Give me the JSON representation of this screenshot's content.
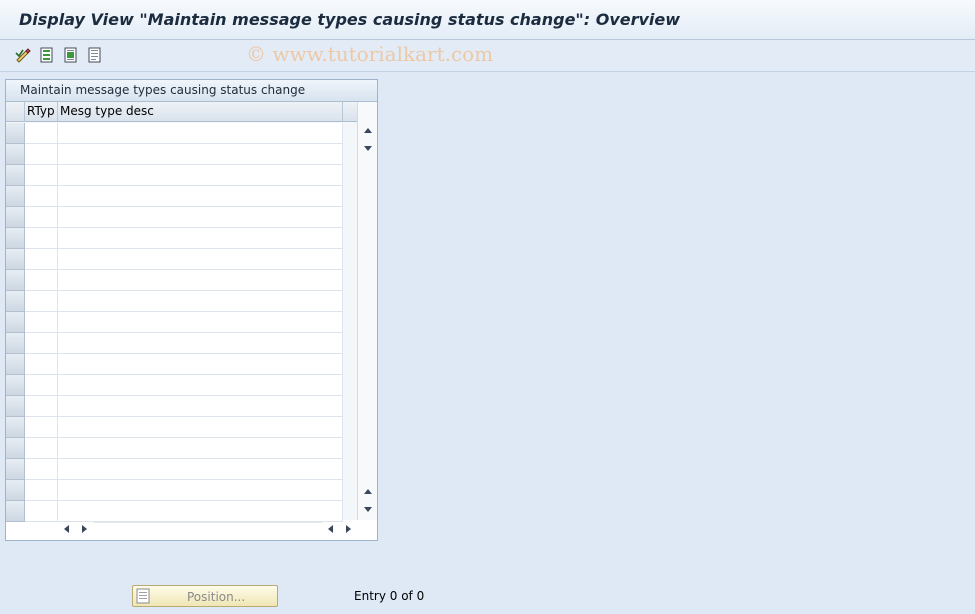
{
  "window": {
    "title": "Display View \"Maintain message types causing status change\": Overview"
  },
  "toolbar": {
    "icons": [
      "display-change-icon",
      "select-all-icon",
      "select-block-icon",
      "deselect-all-icon"
    ],
    "watermark": "© www.tutorialkart.com"
  },
  "table": {
    "title": "Maintain message types causing status change",
    "columns": [
      "RTyp",
      "Mesg type desc"
    ],
    "rows": []
  },
  "footer": {
    "position_label": "Position...",
    "entry_text": "Entry 0 of 0"
  },
  "colors": {
    "background": "#dfe9f5",
    "title_text": "#1c2c3f",
    "button_bg": "#f0e6b4",
    "watermark": "#ecc8a6"
  }
}
